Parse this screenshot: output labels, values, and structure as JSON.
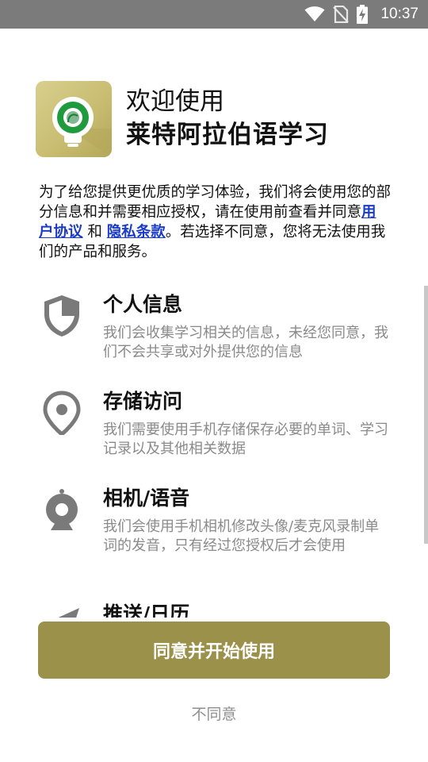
{
  "status_bar": {
    "time": "10:37"
  },
  "header": {
    "welcome": "欢迎使用",
    "app_name": "莱特阿拉伯语学习"
  },
  "intro": {
    "part1": "为了给您提供更优质的学习体验，我们将会使用您的部分信息和并需要相应授权，请在使用前查看并同意",
    "user_agreement": "用户协议",
    "and": " 和 ",
    "privacy_policy": "隐私条款",
    "part2": "。若选择不同意，您将无法使用我们的产品和服务。"
  },
  "permissions": [
    {
      "icon": "shield-icon",
      "title": "个人信息",
      "desc": "我们会收集学习相关的信息，未经您同意，我们不会共享或对外提供您的信息"
    },
    {
      "icon": "location-pin-icon",
      "title": "存储访问",
      "desc": "我们需要使用手机存储保存必要的单词、学习记录以及其他相关数据"
    },
    {
      "icon": "webcam-icon",
      "title": "相机/语音",
      "desc": "我们会使用手机相机修改头像/麦克风录制单词的发音，只有经过您授权后才会使用"
    },
    {
      "icon": "send-icon",
      "title": "推送/日历",
      "desc": ""
    }
  ],
  "buttons": {
    "agree": "同意并开始使用",
    "disagree": "不同意"
  },
  "colors": {
    "accent": "#9c914a",
    "link": "#1a3bc8",
    "status_bar": "#7b7b7b",
    "desc_text": "#8a8a8a"
  }
}
